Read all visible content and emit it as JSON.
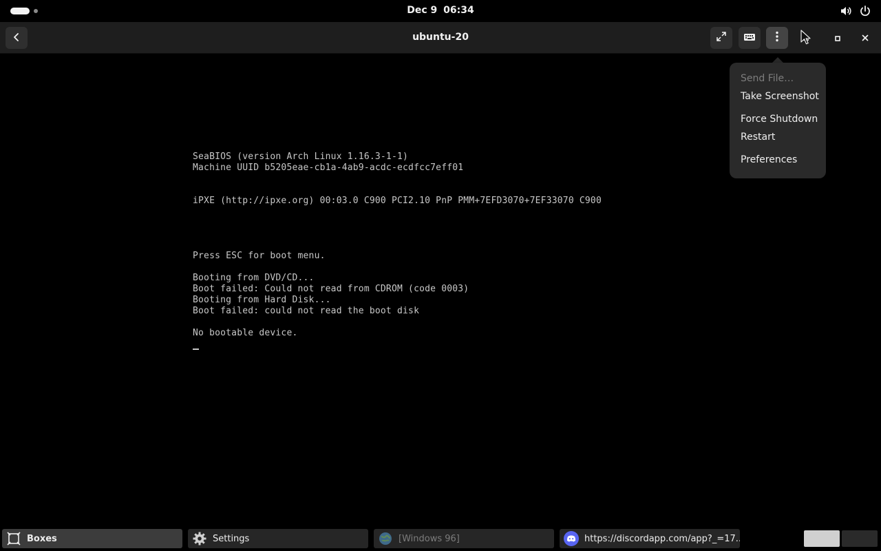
{
  "topbar": {
    "date": "Dec 9",
    "time": "06:34",
    "volume_icon": "speaker-volume-icon",
    "power_icon": "power-icon"
  },
  "headerbar": {
    "title": "ubuntu-20",
    "back_icon": "chevron-left-icon",
    "fullscreen_icon": "fullscreen-icon",
    "keyboard_icon": "keyboard-icon",
    "menu_icon": "vertical-ellipsis-icon",
    "minimize_icon": "minimize-icon",
    "maximize_icon": "maximize-icon",
    "close_icon": "close-icon"
  },
  "console": {
    "lines": [
      "SeaBIOS (version Arch Linux 1.16.3-1-1)",
      "Machine UUID b5205eae-cb1a-4ab9-acdc-ecdfcc7eff01",
      "iPXE (http://ipxe.org) 00:03.0 C900 PCI2.10 PnP PMM+7EFD3070+7EF33070 C900",
      "Press ESC for boot menu.",
      "Booting from DVD/CD...",
      "Boot failed: Could not read from CDROM (code 0003)",
      "Booting from Hard Disk...",
      "Boot failed: could not read the boot disk",
      "No bootable device."
    ]
  },
  "menu": {
    "items": [
      {
        "label": "Send File…",
        "enabled": false
      },
      {
        "label": "Take Screenshot",
        "enabled": true
      },
      {
        "label": "Force Shutdown",
        "enabled": true
      },
      {
        "label": "Restart",
        "enabled": true
      },
      {
        "label": "Preferences",
        "enabled": true
      }
    ]
  },
  "taskbar": {
    "tasks": [
      {
        "label": "Boxes",
        "icon": "boxes-app-icon",
        "active": true
      },
      {
        "label": "Settings",
        "icon": "gear-icon",
        "active": false
      },
      {
        "label": "[Windows 96]",
        "icon": "globe-icon",
        "active": false
      },
      {
        "label": "https://discordapp.com/app?_=17...",
        "icon": "discord-icon",
        "active": false
      }
    ],
    "workspaces": [
      "workspace-1",
      "workspace-2"
    ]
  },
  "colors": {
    "header_bg": "#1e1e1e",
    "popover_bg": "#2a2a2a",
    "console_text": "#c8c8c8",
    "task_active_bg": "#3c3c3c"
  }
}
